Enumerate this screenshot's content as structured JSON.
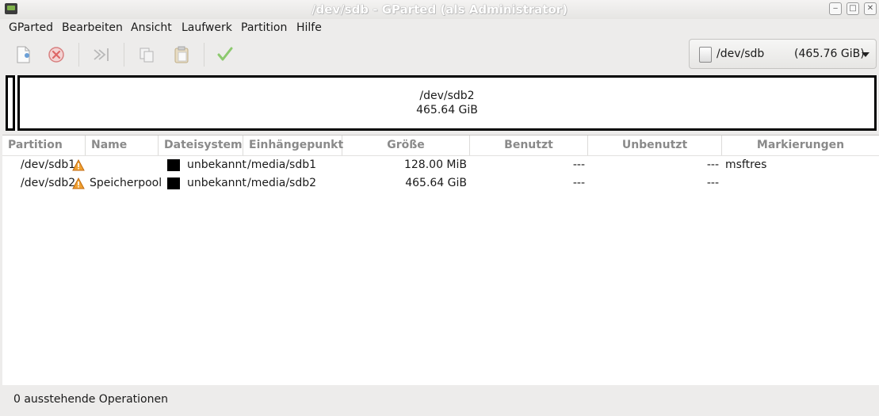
{
  "window": {
    "title": "/dev/sdb - GParted (als Administrator)",
    "buttons": [
      "minimize",
      "maximize",
      "close"
    ]
  },
  "menubar": {
    "items": [
      "GParted",
      "Bearbeiten",
      "Ansicht",
      "Laufwerk",
      "Partition",
      "Hilfe"
    ]
  },
  "toolbar": {
    "buttons": [
      {
        "icon": "new-document-icon",
        "enabled": false
      },
      {
        "icon": "delete-icon",
        "enabled": false
      },
      {
        "icon": "resize-move-icon",
        "enabled": false
      },
      {
        "icon": "copy-icon",
        "enabled": false
      },
      {
        "icon": "paste-icon",
        "enabled": false
      },
      {
        "icon": "apply-icon",
        "enabled": false
      }
    ],
    "device": {
      "name": "/dev/sdb",
      "size": "(465.76 GiB)"
    }
  },
  "disk_visual": {
    "segments": [
      {
        "name": "/dev/sdb1",
        "size": ""
      },
      {
        "name": "/dev/sdb2",
        "size": "465.64 GiB"
      }
    ]
  },
  "table": {
    "headers": [
      "Partition",
      "Name",
      "Dateisystem",
      "Einhängepunkt",
      "Größe",
      "Benutzt",
      "Unbenutzt",
      "Markierungen"
    ],
    "rows": [
      {
        "partition": "/dev/sdb1",
        "warning": true,
        "name": "",
        "filesystem": "unbekannt",
        "fs_color": "#000000",
        "mountpoint": "/media/sdb1",
        "size": "128.00 MiB",
        "used": "---",
        "unused": "---",
        "flags": "msftres"
      },
      {
        "partition": "/dev/sdb2",
        "warning": true,
        "name": "Speicherpool",
        "filesystem": "unbekannt",
        "fs_color": "#000000",
        "mountpoint": "/media/sdb2",
        "size": "465.64 GiB",
        "used": "---",
        "unused": "---",
        "flags": ""
      }
    ]
  },
  "statusbar": {
    "text": "0 ausstehende Operationen"
  },
  "colors": {
    "warning": "#f0a030",
    "background": "#edeceb"
  }
}
